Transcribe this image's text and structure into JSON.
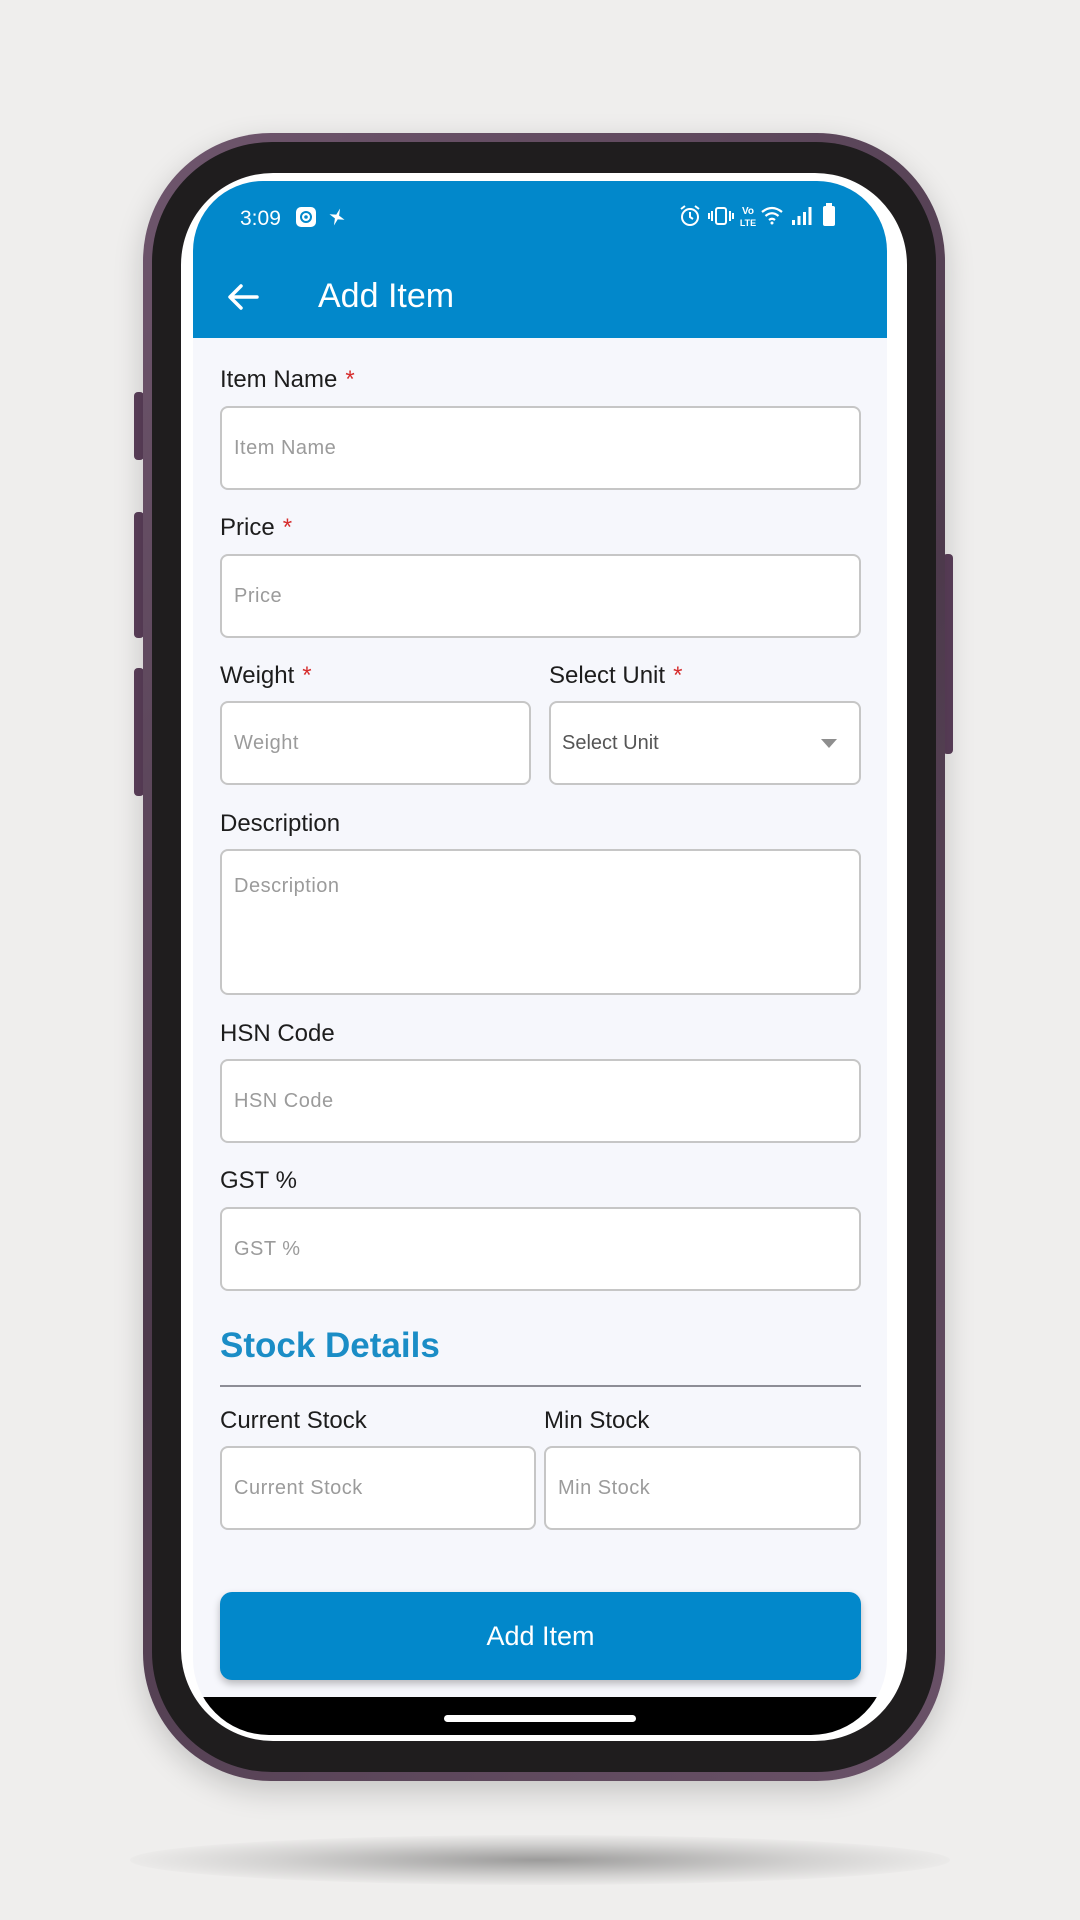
{
  "status_bar": {
    "time": "3:09",
    "left_icons": [
      "settings-badge-icon",
      "sparkle-notification-icon"
    ],
    "right_icons": [
      "alarm-icon",
      "vibrate-icon",
      "volte-icon",
      "wifi-icon",
      "signal-icon",
      "battery-icon"
    ],
    "volte_text_top": "Vo",
    "volte_text_bottom": "LTE"
  },
  "app_bar": {
    "back_icon": "arrow-left-icon",
    "title": "Add Item"
  },
  "form": {
    "required_mark": "*",
    "item_name": {
      "label": "Item Name",
      "placeholder": "Item Name",
      "value": ""
    },
    "price": {
      "label": "Price",
      "placeholder": "Price",
      "value": ""
    },
    "weight": {
      "label": "Weight",
      "placeholder": "Weight",
      "value": ""
    },
    "unit": {
      "label": "Select Unit",
      "selected": "Select Unit"
    },
    "description": {
      "label": "Description",
      "placeholder": "Description",
      "value": ""
    },
    "hsn_code": {
      "label": "HSN Code",
      "placeholder": "HSN Code",
      "value": ""
    },
    "gst": {
      "label": "GST %",
      "placeholder": "GST %",
      "value": ""
    }
  },
  "stock_section": {
    "title": "Stock Details",
    "current_stock": {
      "label": "Current Stock",
      "placeholder": "Current Stock",
      "value": ""
    },
    "min_stock": {
      "label": "Min Stock",
      "placeholder": "Min Stock",
      "value": ""
    }
  },
  "submit": {
    "label": "Add Item"
  },
  "colors": {
    "primary": "#0288cb",
    "section_title": "#1b8dc6",
    "required": "#d62d2d",
    "background": "#f6f7fc",
    "phone_frame": "#5b3f5a"
  }
}
